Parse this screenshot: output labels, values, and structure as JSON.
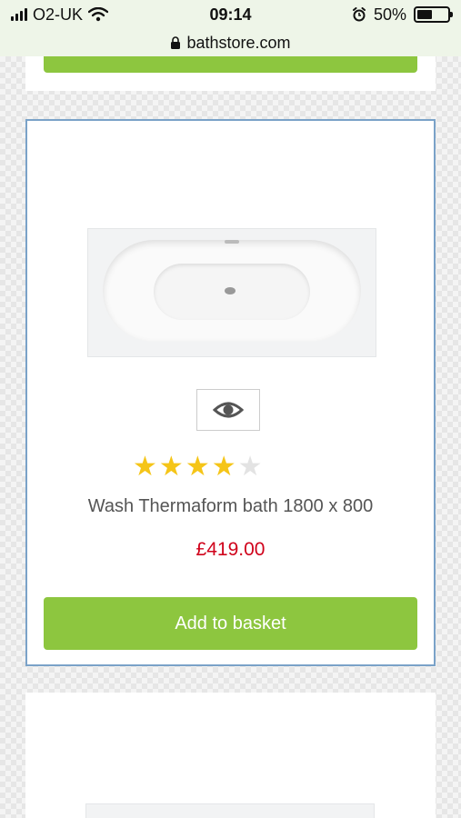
{
  "status_bar": {
    "carrier": "O2-UK",
    "time": "09:14",
    "battery_percent": "50%",
    "battery_level": 0.5
  },
  "url_bar": {
    "domain": "bathstore.com"
  },
  "product": {
    "title": "Wash Thermaform bath 1800 x 800",
    "price": "£419.00",
    "rating": 4,
    "rating_max": 5,
    "add_to_basket_label": "Add to basket"
  },
  "icons": {
    "quick_view": "eye-icon",
    "secure": "lock-icon",
    "alarm": "alarm-clock-icon",
    "wifi": "wifi-icon",
    "signal": "cellular-signal-icon",
    "star": "star-icon"
  },
  "colors": {
    "accent_green": "#8dc63f",
    "price_red": "#d0021b",
    "selected_border": "#7aa2c8",
    "star_on": "#f5c518",
    "star_off": "#e3e3e3"
  }
}
